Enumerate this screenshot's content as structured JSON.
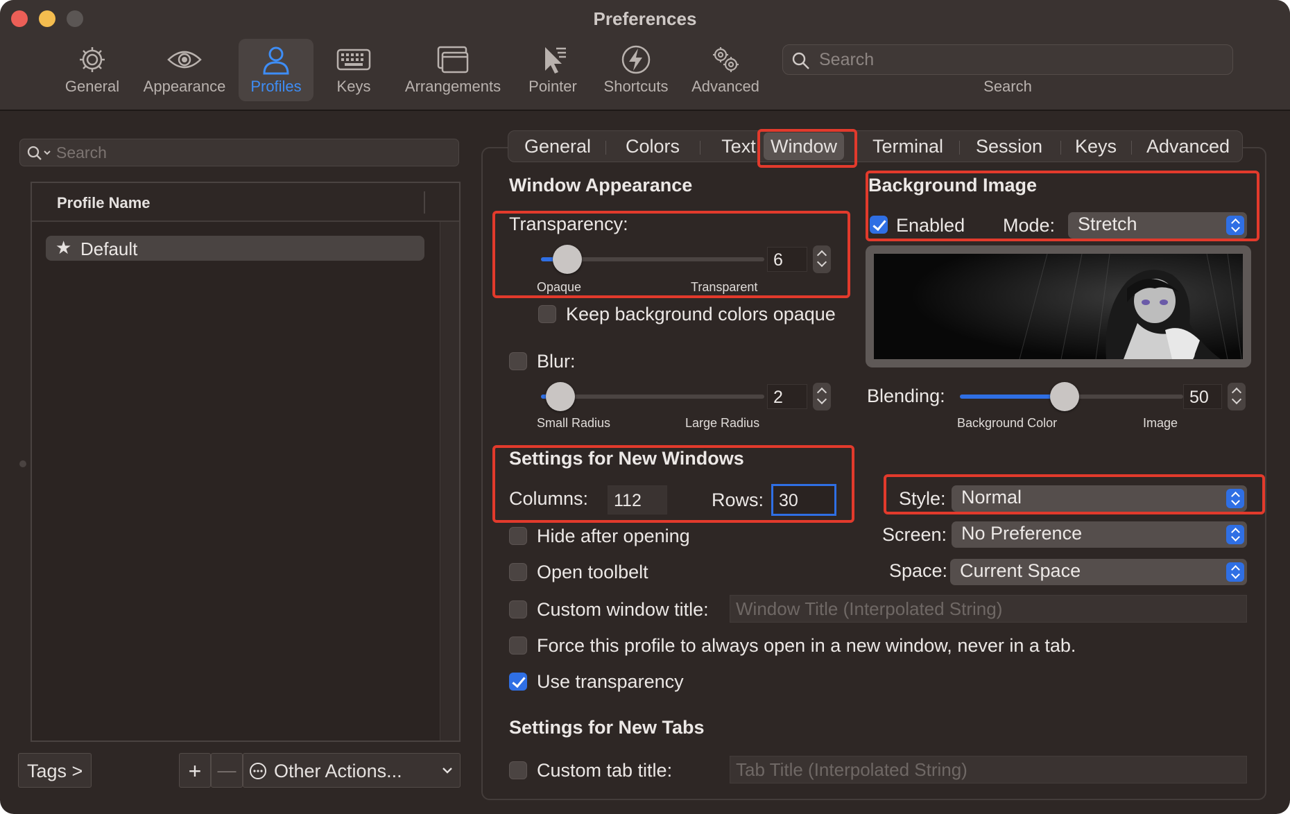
{
  "window": {
    "title": "Preferences"
  },
  "toolbar": {
    "items": [
      {
        "label": "General",
        "icon": "gear-icon"
      },
      {
        "label": "Appearance",
        "icon": "eye-icon"
      },
      {
        "label": "Profiles",
        "icon": "person-icon",
        "selected": true
      },
      {
        "label": "Keys",
        "icon": "keyboard-icon"
      },
      {
        "label": "Arrangements",
        "icon": "windows-icon"
      },
      {
        "label": "Pointer",
        "icon": "pointer-icon"
      },
      {
        "label": "Shortcuts",
        "icon": "bolt-icon"
      },
      {
        "label": "Advanced",
        "icon": "gears-icon"
      }
    ],
    "search_placeholder": "Search",
    "search_label": "Search"
  },
  "sidebar": {
    "search_placeholder": "Search",
    "column_header": "Profile Name",
    "profiles": [
      {
        "name": "Default",
        "default": true
      }
    ],
    "tags_button": "Tags >",
    "add_button": "+",
    "remove_button": "—",
    "other_actions": "Other Actions..."
  },
  "tabs": [
    "General",
    "Colors",
    "Text",
    "Window",
    "Terminal",
    "Session",
    "Keys",
    "Advanced"
  ],
  "selected_tab": "Window",
  "window_appearance": {
    "heading": "Window Appearance",
    "transparency_label": "Transparency:",
    "transparency_value": "6",
    "transparency_min_label": "Opaque",
    "transparency_max_label": "Transparent",
    "keep_bg_opaque_label": "Keep background colors opaque",
    "keep_bg_opaque": false,
    "blur_label": "Blur:",
    "blur_enabled": false,
    "blur_value": "2",
    "blur_min_label": "Small Radius",
    "blur_max_label": "Large Radius"
  },
  "background_image": {
    "heading": "Background Image",
    "enabled_label": "Enabled",
    "enabled": true,
    "mode_label": "Mode:",
    "mode_value": "Stretch",
    "blending_label": "Blending:",
    "blending_value": "50",
    "blending_min_label": "Background Color",
    "blending_max_label": "Image"
  },
  "new_windows": {
    "heading": "Settings for New Windows",
    "columns_label": "Columns:",
    "columns_value": "112",
    "rows_label": "Rows:",
    "rows_value": "30",
    "style_label": "Style:",
    "style_value": "Normal",
    "screen_label": "Screen:",
    "screen_value": "No Preference",
    "space_label": "Space:",
    "space_value": "Current Space",
    "hide_after_opening": "Hide after opening",
    "open_toolbelt": "Open toolbelt",
    "custom_window_title": "Custom window title:",
    "window_title_placeholder": "Window Title (Interpolated String)",
    "force_new_window": "Force this profile to always open in a new window, never in a tab.",
    "use_transparency": "Use transparency",
    "use_transparency_checked": true
  },
  "new_tabs": {
    "heading": "Settings for New Tabs",
    "custom_tab_title": "Custom tab title:",
    "tab_title_placeholder": "Tab Title (Interpolated String)"
  },
  "colors": {
    "accent": "#2f6fe4",
    "highlight": "#e23a2c",
    "window_bg": "#2e2725"
  }
}
